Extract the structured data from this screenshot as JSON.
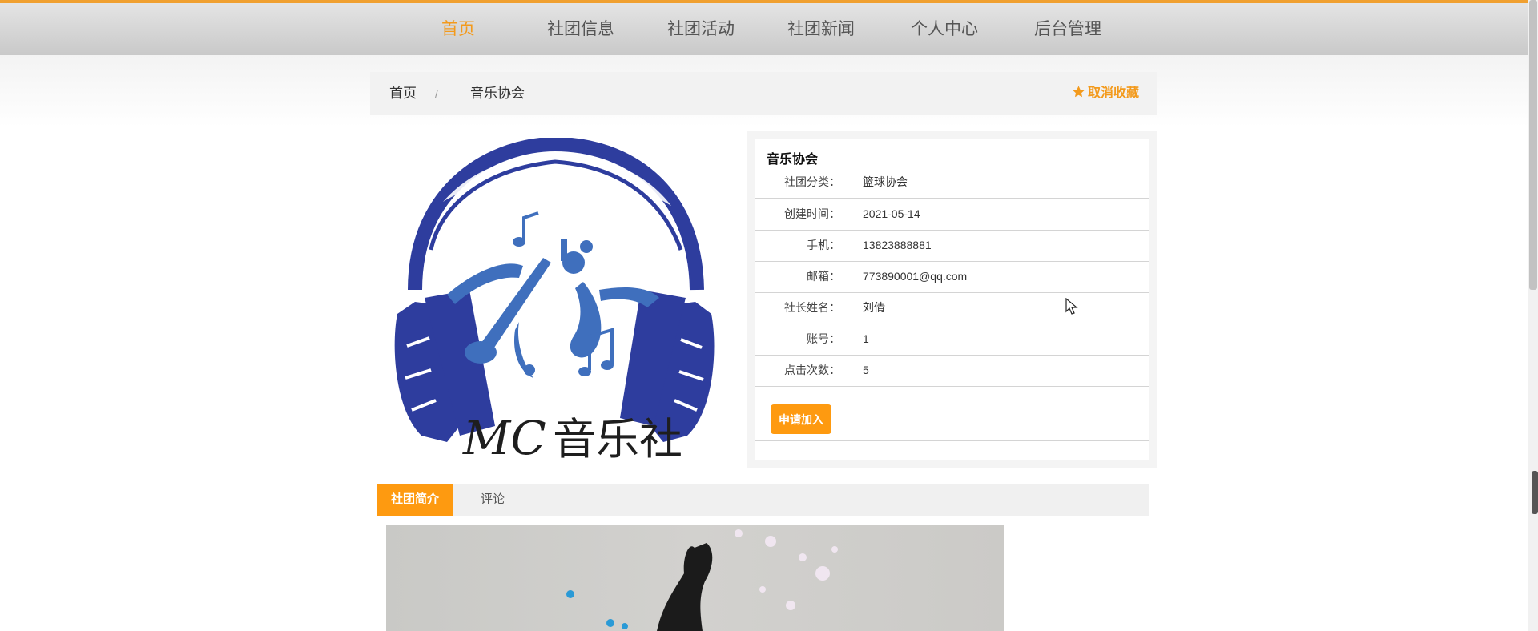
{
  "nav": {
    "items": [
      {
        "label": "首页",
        "active": true
      },
      {
        "label": "社团信息",
        "active": false
      },
      {
        "label": "社团活动",
        "active": false
      },
      {
        "label": "社团新闻",
        "active": false
      },
      {
        "label": "个人中心",
        "active": false
      },
      {
        "label": "后台管理",
        "active": false
      }
    ]
  },
  "breadcrumb": {
    "home": "首页",
    "separator": "/",
    "current": "音乐协会",
    "favorite_label": "取消收藏",
    "favorite_icon": "star-icon"
  },
  "logo": {
    "text": "MC音乐社",
    "accent": "#2e3d9e"
  },
  "club": {
    "name": "音乐协会",
    "fields": [
      {
        "label": "社团分类：",
        "value": "篮球协会"
      },
      {
        "label": "创建时间：",
        "value": "2021-05-14"
      },
      {
        "label": "手机：",
        "value": "13823888881"
      },
      {
        "label": "邮箱：",
        "value": "773890001@qq.com"
      },
      {
        "label": "社长姓名：",
        "value": "刘倩"
      },
      {
        "label": "账号：",
        "value": "1"
      },
      {
        "label": "点击次数：",
        "value": "5"
      }
    ],
    "join_button": "申请加入"
  },
  "tabs": [
    {
      "label": "社团简介",
      "active": true
    },
    {
      "label": "评论",
      "active": false
    }
  ],
  "colors": {
    "accent": "#fe9a10",
    "nav_active": "#f39a1c",
    "top_border": "#f0a030"
  }
}
